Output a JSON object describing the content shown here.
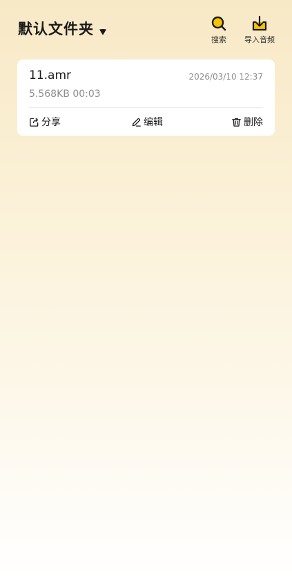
{
  "header": {
    "folder_title": "默认文件夹",
    "search_label": "搜索",
    "import_label": "导入音频"
  },
  "colors": {
    "accent": "#f5c400",
    "background_top": "#f8e9c6",
    "card": "#ffffff"
  },
  "icons": {
    "folder_dropdown": "caret-down-icon",
    "search": "search-icon",
    "import": "import-icon",
    "share": "share-icon",
    "edit": "pencil-icon",
    "delete": "trash-icon"
  },
  "recordings": [
    {
      "name": "11.amr",
      "date": "2026/03/10 12:37",
      "meta": "5.568KB 00:03",
      "actions": {
        "share": "分享",
        "edit": "编辑",
        "delete": "删除"
      }
    }
  ]
}
